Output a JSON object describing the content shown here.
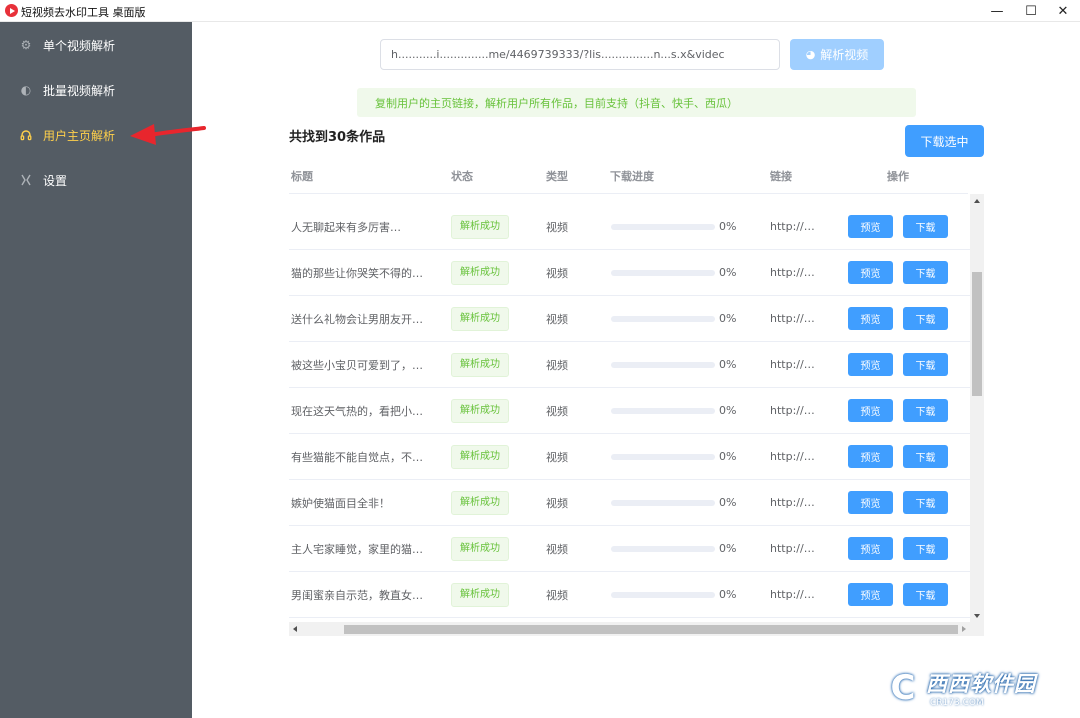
{
  "window": {
    "title": "短视频去水印工具 桌面版",
    "controls": {
      "minimize": "—",
      "maximize": "☐",
      "close": "✕"
    }
  },
  "sidebar": {
    "items": [
      {
        "label": "单个视频解析",
        "icon": "gear-icon",
        "active": false
      },
      {
        "label": "批量视频解析",
        "icon": "half-circle-icon",
        "active": false
      },
      {
        "label": "用户主页解析",
        "icon": "headset-icon",
        "active": true
      },
      {
        "label": "设置",
        "icon": "cross-arrows-icon",
        "active": false
      }
    ]
  },
  "search": {
    "value": "h...........i..............me/4469739333/?lis...............n...s.x&videc",
    "parse_label": "解析视频"
  },
  "tip": "复制用户的主页链接，解析用户所有作品，目前支持（抖音、快手、西瓜）",
  "results": {
    "count_title": "共找到30条作品",
    "download_selected_label": "下载选中"
  },
  "table": {
    "headers": [
      "标题",
      "状态",
      "类型",
      "下载进度",
      "链接",
      "操作"
    ],
    "rows": [
      {
        "title": "人无聊起来有多厉害…",
        "status": "解析成功",
        "type": "视频",
        "progress": "0%",
        "link": "http://…",
        "preview": "预览",
        "download": "下载"
      },
      {
        "title": "猫的那些让你哭笑不得的…",
        "status": "解析成功",
        "type": "视频",
        "progress": "0%",
        "link": "http://…",
        "preview": "预览",
        "download": "下载"
      },
      {
        "title": "送什么礼物会让男朋友开…",
        "status": "解析成功",
        "type": "视频",
        "progress": "0%",
        "link": "http://…",
        "preview": "预览",
        "download": "下载"
      },
      {
        "title": "被这些小宝贝可爱到了，…",
        "status": "解析成功",
        "type": "视频",
        "progress": "0%",
        "link": "http://…",
        "preview": "预览",
        "download": "下载"
      },
      {
        "title": "现在这天气热的，看把小…",
        "status": "解析成功",
        "type": "视频",
        "progress": "0%",
        "link": "http://…",
        "preview": "预览",
        "download": "下载"
      },
      {
        "title": "有些猫能不能自觉点，不…",
        "status": "解析成功",
        "type": "视频",
        "progress": "0%",
        "link": "http://…",
        "preview": "预览",
        "download": "下载"
      },
      {
        "title": "嫉妒使猫面目全非！",
        "status": "解析成功",
        "type": "视频",
        "progress": "0%",
        "link": "http://…",
        "preview": "预览",
        "download": "下载"
      },
      {
        "title": "主人宅家睡觉，家里的猫…",
        "status": "解析成功",
        "type": "视频",
        "progress": "0%",
        "link": "http://…",
        "preview": "预览",
        "download": "下载"
      },
      {
        "title": "男闺蜜亲自示范，教直女…",
        "status": "解析成功",
        "type": "视频",
        "progress": "0%",
        "link": "http://…",
        "preview": "预览",
        "download": "下载"
      }
    ]
  },
  "watermark": {
    "logo": "C",
    "name": "西西软件园",
    "domain": "CR173.COM"
  },
  "colors": {
    "sidebar_bg": "#545c64",
    "active_nav": "#ffd04b",
    "primary": "#409eff",
    "primary_disabled": "#a0cfff",
    "success": "#67c23a",
    "annotation_arrow": "#e8262d"
  }
}
